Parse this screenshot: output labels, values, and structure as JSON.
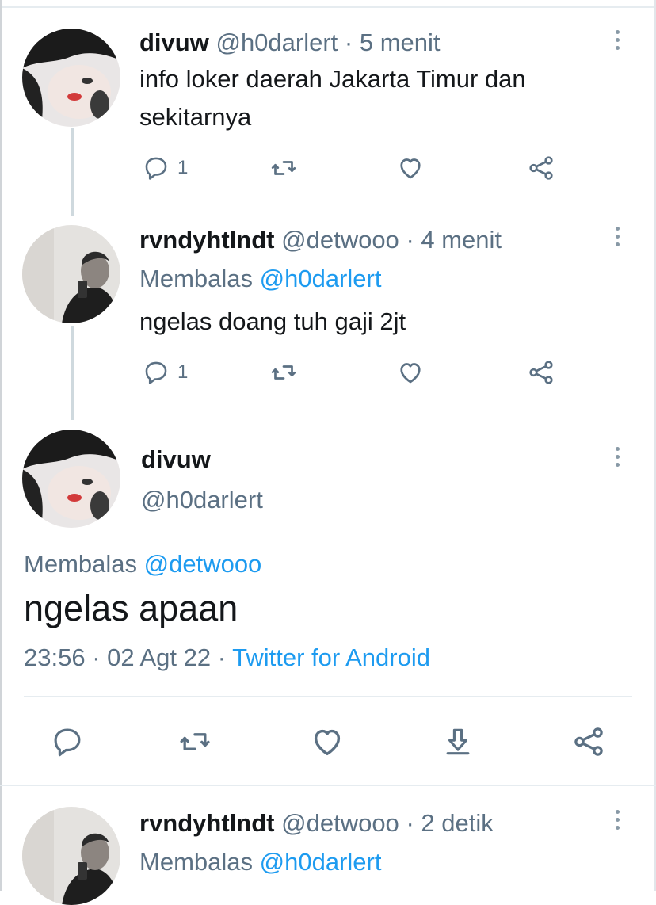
{
  "tweet1": {
    "name": "divuw",
    "handle": "@h0darlert",
    "time": "· 5 menit",
    "text_line1": "info loker daerah Jakarta Timur dan",
    "text_line2": "sekitarnya",
    "reply_count": "1"
  },
  "tweet2": {
    "name": "rvndyhtlndt",
    "handle": "@detwooo",
    "time": "· 4 menit",
    "replying_prefix": "Membalas",
    "replying_to": "@h0darlert",
    "text": "ngelas doang tuh gaji 2jt",
    "reply_count": "1"
  },
  "main": {
    "name": "divuw",
    "handle": "@h0darlert",
    "replying_prefix": "Membalas",
    "replying_to": "@detwooo",
    "text": "ngelas apaan",
    "timestamp": "23:56 · 02 Agt 22 ·",
    "source": "Twitter for Android"
  },
  "tweet3": {
    "name": "rvndyhtlndt",
    "handle": "@detwooo",
    "time": "· 2 detik",
    "replying_prefix": "Membalas",
    "replying_to": "@h0darlert"
  },
  "colors": {
    "accent": "#1d9bf0",
    "muted": "#5b7083",
    "divider": "#e6ecf0"
  },
  "icons": [
    "reply-icon",
    "retweet-icon",
    "like-icon",
    "share-icon",
    "download-icon",
    "more-icon"
  ]
}
